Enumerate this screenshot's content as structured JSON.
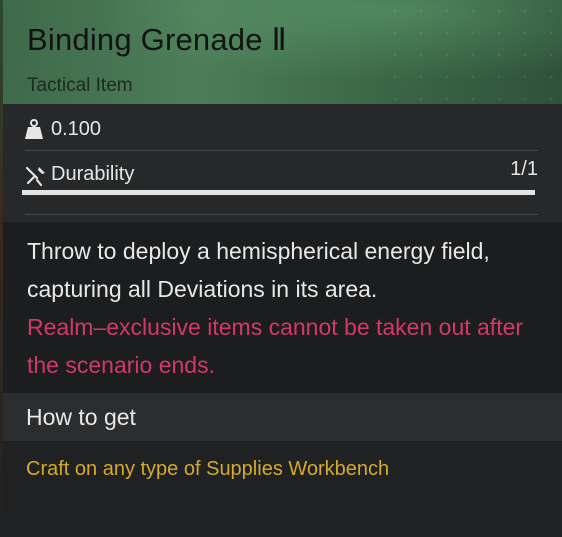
{
  "item": {
    "name": "Binding Grenade Ⅱ",
    "category": "Tactical Item",
    "weight": "0.100",
    "durability_label": "Durability",
    "durability_value": "1/1",
    "durability_fraction": 1.0,
    "description": "Throw to deploy a hemispherical energy field, capturing all Deviations in its area.",
    "warning": "Realm–exclusive items cannot be taken out after the scenario ends."
  },
  "how_to_get": {
    "title": "How to get",
    "source": "Craft on any type of Supplies Workbench"
  },
  "icons": {
    "weight": "weight-icon",
    "durability": "wrench-screwdriver-icon"
  },
  "colors": {
    "header": "#4c7d58",
    "warning": "#d3386a",
    "source": "#d4a92e"
  }
}
